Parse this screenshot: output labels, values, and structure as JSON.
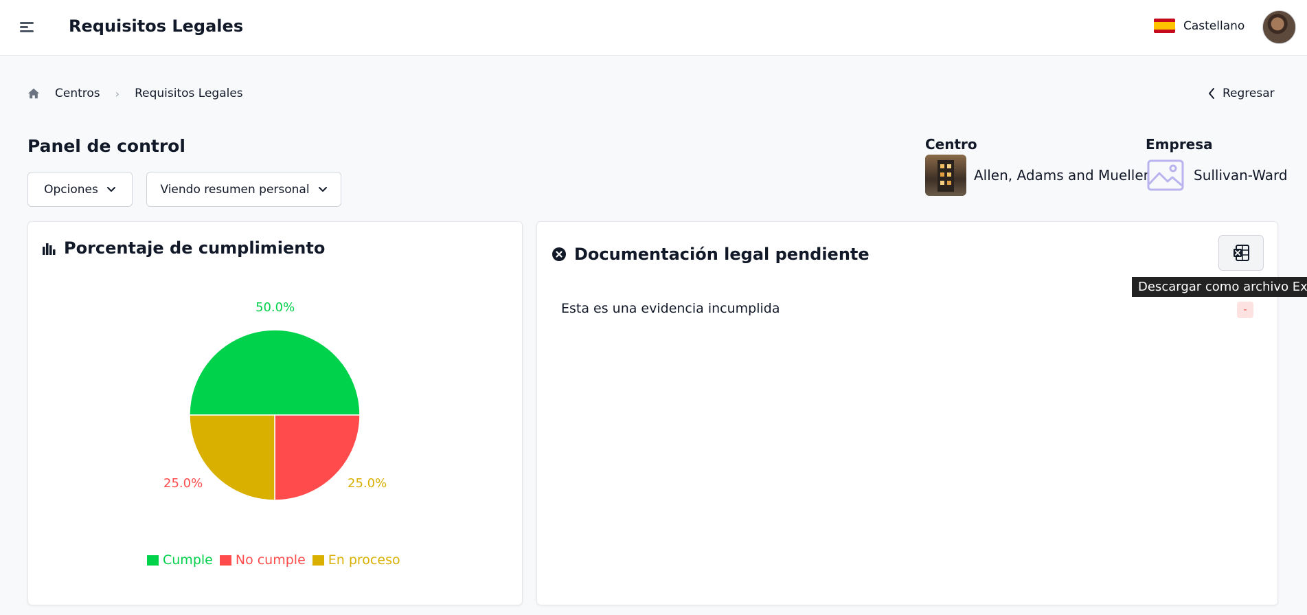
{
  "header": {
    "title": "Requisitos Legales",
    "language_label": "Castellano",
    "icons": [
      "menu-icon",
      "spain-flag-icon",
      "user-avatar"
    ]
  },
  "breadcrumb": {
    "items": [
      "Centros",
      "Requisitos Legales"
    ],
    "back_label": "Regresar"
  },
  "dashboard": {
    "title": "Panel de control",
    "options_label": "Opciones",
    "view_label": "Viendo resumen personal",
    "centro_label": "Centro",
    "centro_value": "Allen, Adams and Mueller",
    "empresa_label": "Empresa",
    "empresa_value": "Sullivan-Ward"
  },
  "compliance_card": {
    "title": "Porcentaje de cumplimiento"
  },
  "pending_card": {
    "title": "Documentación legal pendiente",
    "excel_tooltip": "Descargar como archivo Exce",
    "items": [
      {
        "label": "Esta es una evidencia incumplida",
        "badge": "-"
      }
    ]
  },
  "colors": {
    "cumple": "#00d24b",
    "no_cumple": "#ff4b4b",
    "en_proceso": "#d9b000"
  },
  "chart_data": {
    "type": "pie",
    "categories": [
      "Cumple",
      "No cumple",
      "En proceso"
    ],
    "values": [
      50.0,
      25.0,
      25.0
    ],
    "labels": [
      "50.0%",
      "25.0%",
      "25.0%"
    ],
    "colors": [
      "#00d24b",
      "#ff4b4b",
      "#d9b000"
    ],
    "legend": "bottom"
  }
}
